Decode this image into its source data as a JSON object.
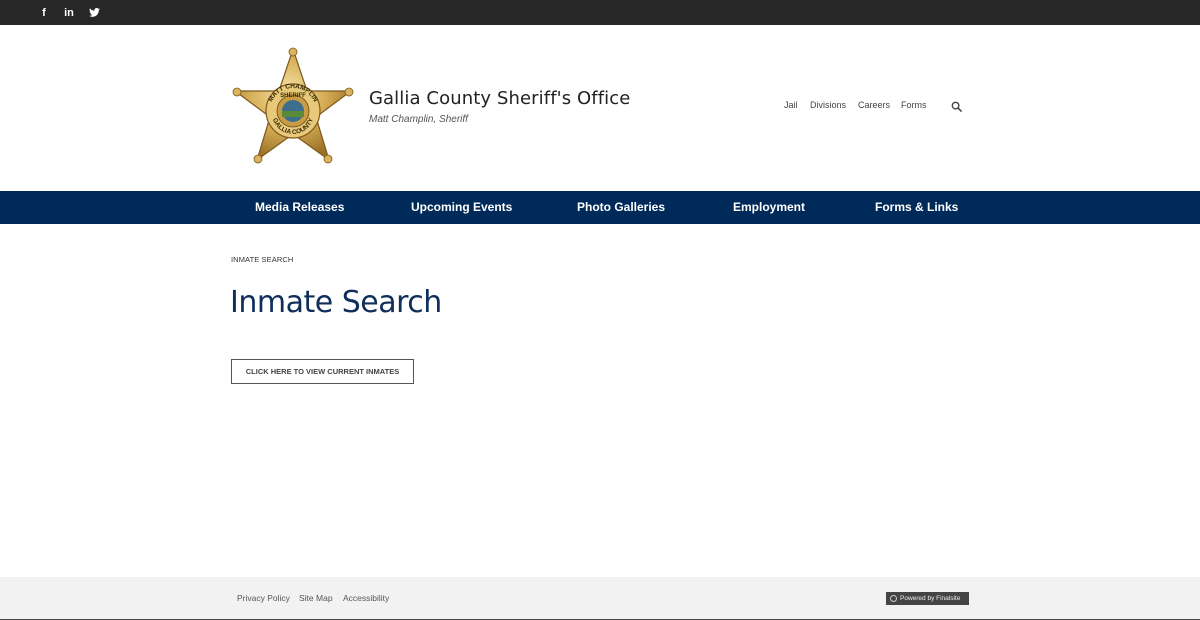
{
  "social": {
    "facebook_glyph": "f",
    "linkedin_glyph": "in",
    "twitter_glyph": "t",
    "icons": [
      "facebook-icon",
      "linkedin-icon",
      "twitter-icon"
    ]
  },
  "header": {
    "title": "Gallia County Sheriff's Office",
    "subtitle": "Matt Champlin, Sheriff",
    "badge_text_top": "MATT CHAMPLIN",
    "badge_text_mid": "SHERIFF",
    "badge_text_bottom": "GALLIA COUNTY"
  },
  "utility_nav": {
    "items": [
      "Jail",
      "Divisions",
      "Careers",
      "Forms"
    ],
    "search_icon": "search-icon"
  },
  "main_nav": {
    "items": [
      "Media Releases",
      "Upcoming Events",
      "Photo Galleries",
      "Employment",
      "Forms & Links"
    ]
  },
  "content": {
    "breadcrumb": "INMATE SEARCH",
    "title": "Inmate Search",
    "button_label": "CLICK HERE TO VIEW CURRENT INMATES"
  },
  "footer": {
    "links": [
      "Privacy Policy",
      "Site Map",
      "Accessibility"
    ],
    "powered_by": "Powered by Finalsite"
  },
  "colors": {
    "nav_bg": "#002a59",
    "title_color": "#0f2f5a",
    "topbar_bg": "#272727",
    "footer_bg": "#f2f2f2",
    "badge_gold": "#c9a24a"
  }
}
